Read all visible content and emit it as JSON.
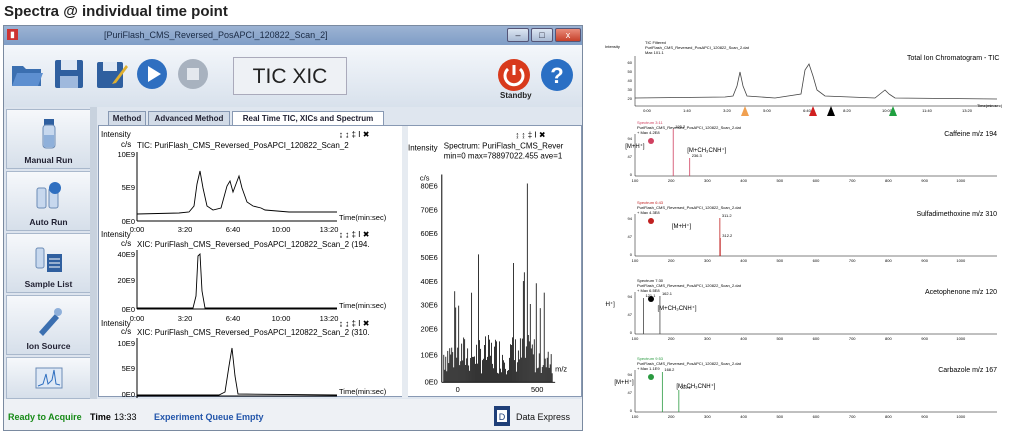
{
  "heading": "Spectra @ individual time point",
  "window": {
    "title": "[PuriFlash_CMS_Reversed_PosAPCI_120822_Scan_2]",
    "min": "–",
    "max": "□",
    "close": "x"
  },
  "toolbar": {
    "display_label": "TIC XIC",
    "standby_label": "Standby",
    "help_symbol": "?"
  },
  "sidebar": {
    "items": [
      {
        "label": "Manual Run"
      },
      {
        "label": "Auto Run"
      },
      {
        "label": "Sample List"
      },
      {
        "label": "Ion Source"
      }
    ]
  },
  "tabs": [
    {
      "label": "Method"
    },
    {
      "label": "Advanced Method"
    },
    {
      "label": "Real Time TIC, XICs and Spectrum"
    }
  ],
  "plots": {
    "tic": {
      "ylabel_top": "Intensity",
      "unit": "c/s",
      "title": "TIC: PuriFlash_CMS_Reversed_PosAPCI_120822_Scan_2",
      "yticks": [
        "10E9",
        "5E9",
        "0E0"
      ],
      "xticks": [
        "0:00",
        "3:20",
        "6:40",
        "10:00",
        "13:20"
      ],
      "xlabel": "Time(min:sec)"
    },
    "xic1": {
      "ylabel_top": "Intensity",
      "unit": "c/s",
      "title": "XIC: PuriFlash_CMS_Reversed_PosAPCI_120822_Scan_2 (194.",
      "yticks": [
        "40E9",
        "20E9",
        "0E0"
      ],
      "xticks": [
        "0:00",
        "3:20",
        "6:40",
        "10:00",
        "13:20"
      ],
      "xlabel": "Time(min:sec)"
    },
    "xic2": {
      "ylabel_top": "Intensity",
      "unit": "c/s",
      "title": "XIC: PuriFlash_CMS_Reversed_PosAPCI_120822_Scan_2 (310.",
      "yticks": [
        "10E9",
        "5E9",
        "0E0"
      ],
      "xticks": [
        "0:00",
        "3:20",
        "6:40",
        "10:00",
        "13:20"
      ],
      "xlabel": "Time(min:sec)"
    },
    "plot_tool_icons": "↨ ↨ ‡ Ⅰ ✖",
    "spectrum": {
      "ylabel_top": "Intensity",
      "title": "Spectrum: PuriFlash_CMS_Rever",
      "stats": "min=0 max=78897022.455 ave=1",
      "unit": "c/s",
      "yticks": [
        "80E6",
        "70E6",
        "60E6",
        "50E6",
        "40E6",
        "30E6",
        "20E6",
        "10E6",
        "0E0"
      ],
      "xticks": [
        "0",
        "500"
      ],
      "xlabel": "m/z"
    }
  },
  "status": {
    "ready": "Ready to Acquire",
    "time_label": "Time",
    "time_value": "13:33",
    "queue": "Experiment Queue Empty",
    "data_express": "Data Express"
  },
  "figure": {
    "panels": [
      {
        "header": [
          "TIC Filtered",
          "PuriFlash_CMS_Reversed_PosAPCI_120822_Scan_2.dat",
          "Max 101.1"
        ],
        "title": "Total Ion Chromatogram - TIC",
        "ylabel": "Intensity",
        "xlabel": "Time(min:sec)",
        "xticks": [
          "0:00",
          "1:40",
          "3:20",
          "5:00",
          "6:40",
          "8:20",
          "10:00",
          "11:40",
          "13:20"
        ],
        "yticks": [
          "60",
          "50",
          "40",
          "30",
          "20"
        ]
      },
      {
        "header": [
          "Spectrum 3:11",
          "PuriFlash_CMS_Reversed_PosAPCI_120822_Scan_2.dat",
          "+ Max 4.2E8"
        ],
        "title": "Caffeine m/z 194",
        "ion1": "[M+H⁺]",
        "ion2": "[M+CH₃CNH⁺]",
        "peak_labels": [
          "195.2",
          "236.3"
        ],
        "yticks": [
          "94",
          "47",
          "0"
        ],
        "xticks": [
          "100",
          "200",
          "300",
          "400",
          "500",
          "600",
          "700",
          "800",
          "900",
          "1000"
        ]
      },
      {
        "header": [
          "Spectrum 6:43",
          "PuriFlash_CMS_Reversed_PosAPCI_120822_Scan_2.dat",
          "+ Max 4.3E8"
        ],
        "title": "Sulfadimethoxine m/z 310",
        "ion1": "[M+H⁺]",
        "peak_labels": [
          "311.2",
          "312.2"
        ],
        "yticks": [
          "94",
          "47",
          "0"
        ],
        "xticks": [
          "100",
          "200",
          "300",
          "400",
          "500",
          "600",
          "700",
          "800",
          "900",
          "1000"
        ]
      },
      {
        "header": [
          "Spectrum 7:30",
          "PuriFlash_CMS_Reversed_PosAPCI_120822_Scan_2.dat",
          "+ Max 6.5E8"
        ],
        "title": "Acetophenone m/z 120",
        "ion1": "[M+H⁺]",
        "ion2": "[M+CH₃CNH⁺]",
        "peak_labels": [
          "121.1",
          "162.1"
        ],
        "yticks": [
          "94",
          "47",
          "0"
        ],
        "xticks": [
          "100",
          "200",
          "300",
          "400",
          "500",
          "600",
          "700",
          "800",
          "900",
          "1000"
        ]
      },
      {
        "header": [
          "Spectrum 9:53",
          "PuriFlash_CMS_Reversed_PosAPCI_120822_Scan_2.dat",
          "+ Max 1.1E9"
        ],
        "title": "Carbazole m/z 167",
        "ion1": "[M+H⁺]",
        "ion2": "[M+CH₃CNH⁺]",
        "peak_labels": [
          "168.2",
          "209.2"
        ],
        "yticks": [
          "94",
          "47",
          "0"
        ],
        "xticks": [
          "100",
          "200",
          "300",
          "400",
          "500",
          "600",
          "700",
          "800",
          "900",
          "1000"
        ]
      }
    ]
  },
  "colors": {
    "accent_blue": "#2255aa",
    "ready_green": "#178a17",
    "standby_red": "#d83a1c",
    "help_blue": "#2a6fc4"
  }
}
